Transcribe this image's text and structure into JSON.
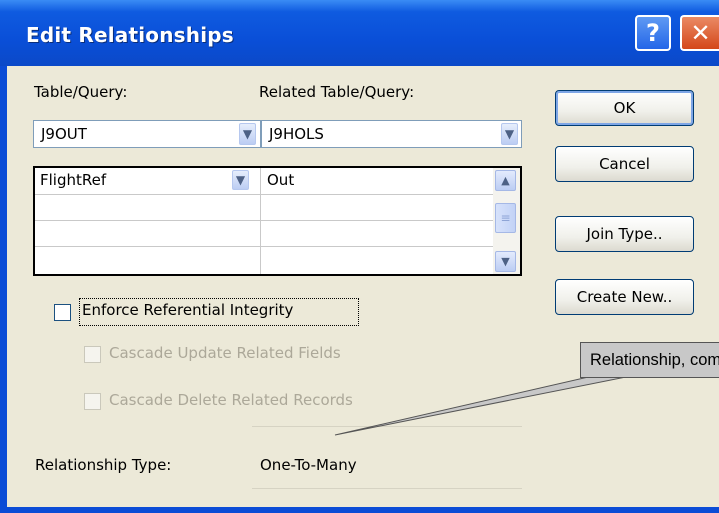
{
  "window": {
    "title": "Edit Relationships",
    "help_glyph": "?",
    "close_glyph": "✕"
  },
  "fields": {
    "table_query_label": "Table/Query:",
    "related_label": "Related Table/Query:",
    "table_value": "J9OUT",
    "related_value": "J9HOLS"
  },
  "grid": {
    "rows": [
      {
        "left": "FlightRef",
        "right": "Out"
      },
      {
        "left": "",
        "right": ""
      },
      {
        "left": "",
        "right": ""
      },
      {
        "left": "",
        "right": ""
      }
    ]
  },
  "buttons": {
    "ok": "OK",
    "cancel": "Cancel",
    "join_type": "Join Type..",
    "create_new": "Create New.."
  },
  "options": {
    "enforce": "Enforce Referential Integrity",
    "cascade_update": "Cascade Update Related Fields",
    "cascade_delete": "Cascade Delete Related Records"
  },
  "relationship": {
    "type_label": "Relationship Type:",
    "type_value": "One-To-Many"
  },
  "callout": {
    "text": "Relationship, com"
  },
  "colors": {
    "titlebar": "#0b4cd6",
    "dialog_bg": "#ece9d8",
    "close_btn": "#d4471a",
    "callout_bg": "#c8c8c8"
  }
}
